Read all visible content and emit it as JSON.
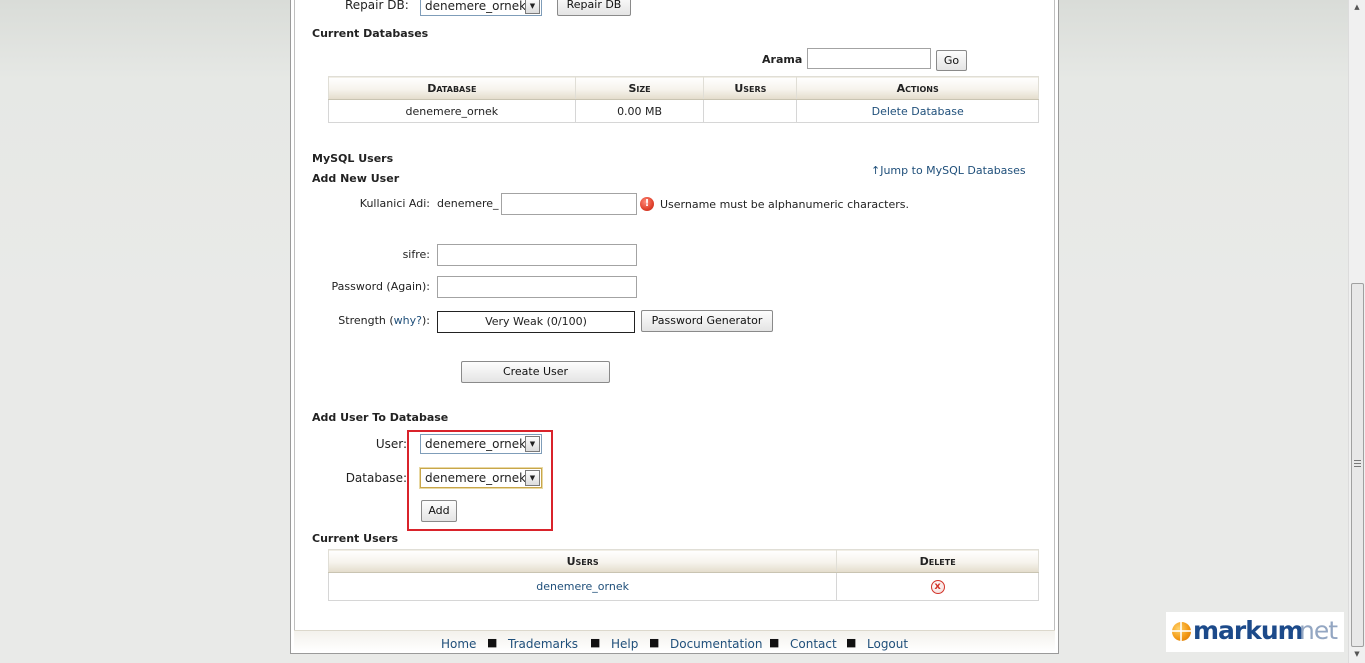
{
  "repair": {
    "label": "Repair DB:",
    "selected": "denemere_ornek",
    "button": "Repair DB"
  },
  "current_databases": {
    "title": "Current Databases",
    "search_label": "Arama",
    "search_value": "",
    "go_button": "Go",
    "columns": [
      "Database",
      "Size",
      "Users",
      "Actions"
    ],
    "rows": [
      {
        "database": "denemere_ornek",
        "size": "0.00 MB",
        "users": "",
        "action": "Delete Database"
      }
    ]
  },
  "mysql_users": {
    "title": "MySQL Users",
    "jump_link": "Jump to MySQL Databases",
    "add_new_user": {
      "title": "Add New User",
      "username_label": "Kullanici Adi:",
      "username_prefix": "denemere_",
      "username_value": "",
      "username_error": "Username must be alphanumeric characters.",
      "password_label": "sifre:",
      "password_again_label": "Password (Again):",
      "strength_label_pre": "Strength (",
      "strength_why": "why?",
      "strength_label_post": "):",
      "strength_value": "Very Weak (0/100)",
      "password_generator_button": "Password Generator",
      "create_button": "Create User"
    }
  },
  "add_user_to_db": {
    "title": "Add User To Database",
    "user_label": "User:",
    "user_selected": "denemere_ornek",
    "database_label": "Database:",
    "database_selected": "denemere_ornek",
    "add_button": "Add"
  },
  "current_users": {
    "title": "Current Users",
    "columns": [
      "Users",
      "Delete"
    ],
    "rows": [
      {
        "user": "denemere_ornek"
      }
    ]
  },
  "footer": {
    "links": [
      "Home",
      "Trademarks",
      "Help",
      "Documentation",
      "Contact",
      "Logout"
    ],
    "separator": "■"
  },
  "logo": {
    "part1": "markum",
    "part2": "net"
  },
  "icons": {
    "error": "exclamation-icon",
    "delete": "delete-x-icon",
    "jump": "arrow-up-icon",
    "dropdown": "chevron-down-icon"
  }
}
